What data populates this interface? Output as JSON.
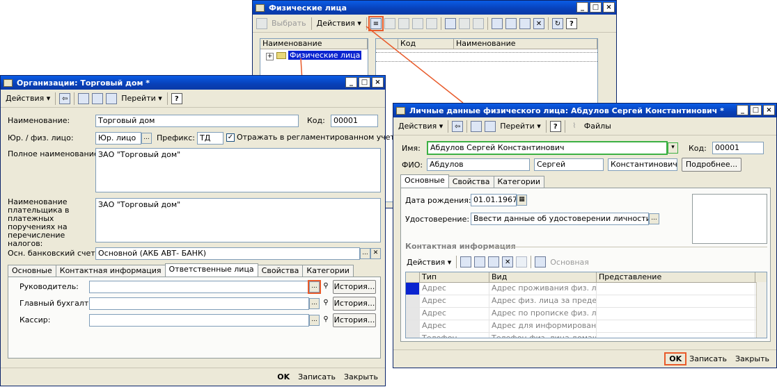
{
  "colors": {
    "accent": "#e85a2a",
    "focus_green": "#3cb043",
    "title_blue": "#0a5ce6"
  },
  "window_persons": {
    "title": "Физические лица",
    "toolbar": {
      "select_label": "Выбрать",
      "actions_label": "Действия"
    },
    "tree": {
      "header": "Наименование",
      "root_label": "Физические лица"
    },
    "list": {
      "columns": [
        "Код",
        "Наименование"
      ]
    }
  },
  "window_org": {
    "title": "Организации: Торговый дом *",
    "toolbar": {
      "actions_label": "Действия",
      "goto_label": "Перейти"
    },
    "labels": {
      "name": "Наименование:",
      "code": "Код:",
      "legal_type": "Юр. / физ. лицо:",
      "prefix": "Префикс:",
      "reflect": "Отражать в регламентированном учете",
      "full_name": "Полное наименование:",
      "payer_name": "Наименование плательщика в платежных поручениях на перечисление налогов:",
      "bank_account": "Осн. банковский счет:"
    },
    "values": {
      "name": "Торговый дом",
      "code": "00001",
      "legal_type": "Юр. лицо",
      "prefix": "ТД",
      "full_name": "ЗАО \"Торговый дом\"",
      "payer_name": "ЗАО \"Торговый дом\"",
      "bank_account": "Основной (АКБ АВТ- БАНК)"
    },
    "tabs": [
      "Основные",
      "Контактная информация",
      "Ответственные лица",
      "Свойства",
      "Категории"
    ],
    "active_tab": "Ответственные лица",
    "responsible": [
      {
        "label": "Руководитель:",
        "history": "История..."
      },
      {
        "label": "Главный бухгалтер:",
        "history": "История..."
      },
      {
        "label": "Кассир:",
        "history": "История..."
      }
    ],
    "status": {
      "ok": "OK",
      "write": "Записать",
      "close": "Закрыть"
    }
  },
  "window_person": {
    "title": "Личные данные физического лица: Абдулов Сергей Константинович *",
    "toolbar": {
      "actions_label": "Действия",
      "goto_label": "Перейти",
      "files_label": "Файлы"
    },
    "labels": {
      "name": "Имя:",
      "code": "Код:",
      "fio": "ФИО:",
      "more": "Подробнее...",
      "birth_date": "Дата рождения:",
      "id_doc": "Удостоверение:",
      "contact_section": "Контактная информация"
    },
    "values": {
      "name": "Абдулов Сергей Константинович",
      "code": "00001",
      "last_name": "Абдулов",
      "first_name": "Сергей",
      "middle_name": "Константинович",
      "birth_date": "01.01.1967",
      "id_doc": "Ввести данные об удостоверении личности"
    },
    "tabs": [
      "Основные",
      "Свойства",
      "Категории"
    ],
    "active_tab": "Основные",
    "contact_toolbar": {
      "actions_label": "Действия",
      "main_label": "Основная"
    },
    "contact_columns": [
      "Тип",
      "Вид",
      "Представление"
    ],
    "contact_rows": [
      {
        "type": "Адрес",
        "kind": "Адрес проживания физ. лица",
        "repr": ""
      },
      {
        "type": "Адрес",
        "kind": "Адрес физ. лица за предел...",
        "repr": ""
      },
      {
        "type": "Адрес",
        "kind": "Адрес по прописке физ. лица",
        "repr": ""
      },
      {
        "type": "Адрес",
        "kind": "Адрес для информировани...",
        "repr": ""
      },
      {
        "type": "Телефон",
        "kind": "Телефон физ. лица домашн...",
        "repr": ""
      }
    ],
    "status": {
      "ok": "OK",
      "write": "Записать",
      "close": "Закрыть"
    }
  }
}
